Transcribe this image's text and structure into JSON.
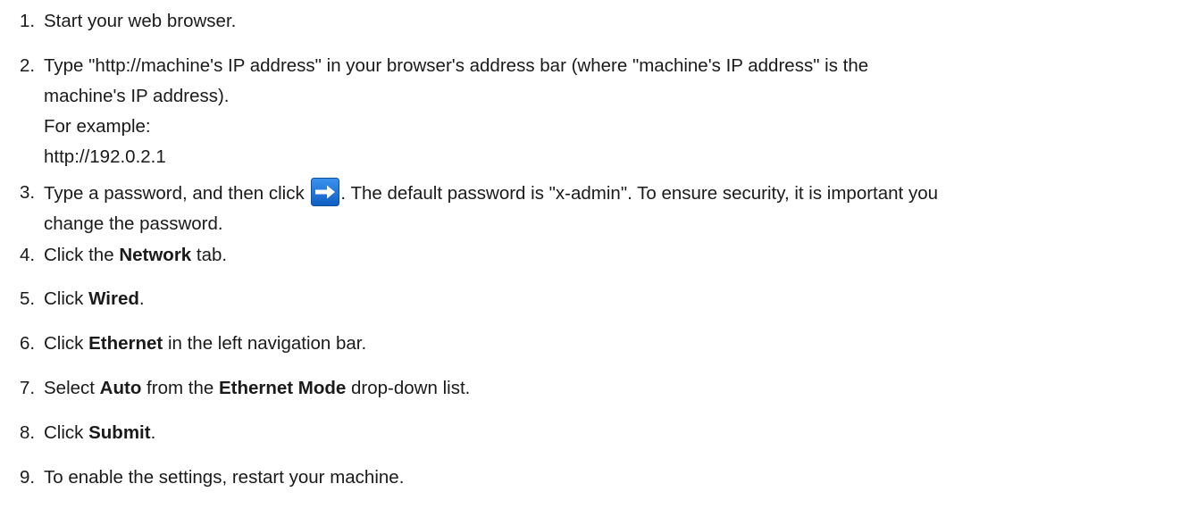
{
  "steps": [
    {
      "number": "1.",
      "text": "Start your web browser."
    },
    {
      "number": "2.",
      "line1": "Type \"http://machine's IP address\" in your browser's address bar (where \"machine's IP address\" is the",
      "line2": "machine's IP address).",
      "line3": "For example:",
      "line4": "http://192.0.2.1"
    },
    {
      "number": "3.",
      "before_icon": "Type a password, and then click ",
      "icon": "right-arrow-icon",
      "after_icon": ". The default password is \"x-admin\". To ensure security, it is important you",
      "line2": "change the password."
    },
    {
      "number": "4.",
      "prefix": "Click the ",
      "bold": "Network",
      "suffix": " tab."
    },
    {
      "number": "5.",
      "prefix": "Click ",
      "bold": "Wired",
      "suffix": "."
    },
    {
      "number": "6.",
      "prefix": "Click ",
      "bold": "Ethernet",
      "suffix": " in the left navigation bar."
    },
    {
      "number": "7.",
      "prefix": "Select ",
      "bold1": "Auto",
      "middle": " from the ",
      "bold2": "Ethernet Mode",
      "suffix": " drop-down list."
    },
    {
      "number": "8.",
      "prefix": "Click ",
      "bold": "Submit",
      "suffix": "."
    },
    {
      "number": "9.",
      "text": "To enable the settings, restart your machine."
    }
  ],
  "colors": {
    "icon_bg": "#1e73d6",
    "icon_arrow": "#ffffff",
    "text": "#1a1a1a"
  }
}
